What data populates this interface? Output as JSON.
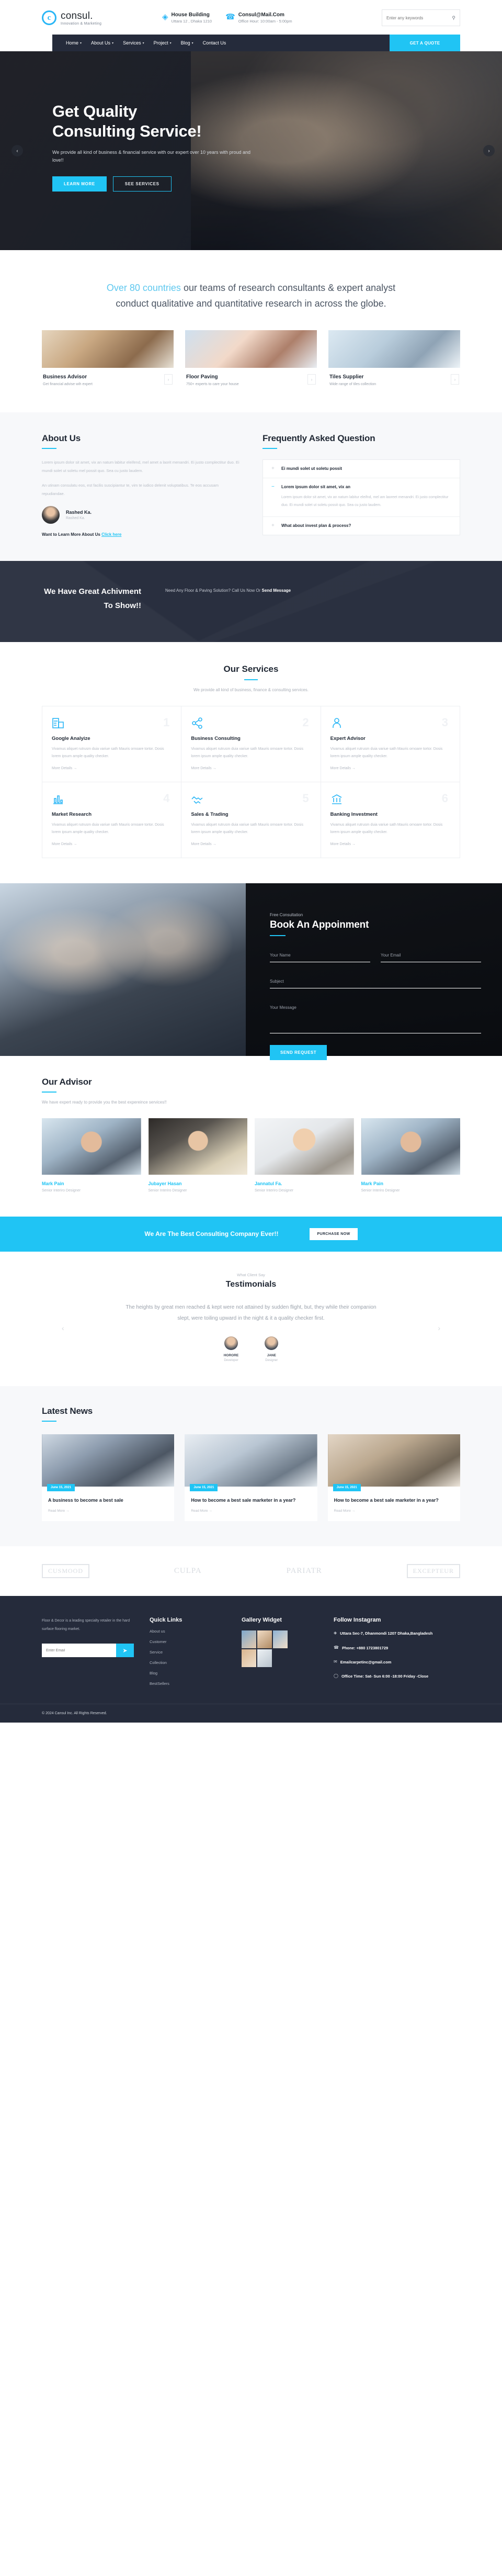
{
  "header": {
    "logo_letter": "c",
    "logo_name": "consul.",
    "logo_tagline": "Innovation & Marketing",
    "info": [
      {
        "icon": "location-pin-icon",
        "title": "House Building",
        "sub": "Uttara 12 , Dhaka 1210"
      },
      {
        "icon": "phone-icon",
        "title": "Consul@Mail.Com",
        "sub": "Office Hour: 10:00am - 5:00pm"
      }
    ],
    "search_placeholder": "Enter any keywords",
    "search_value": ""
  },
  "nav": {
    "items": [
      {
        "label": "Home",
        "has_caret": true
      },
      {
        "label": "About Us",
        "has_caret": true
      },
      {
        "label": "Services",
        "has_caret": true
      },
      {
        "label": "Project",
        "has_caret": true
      },
      {
        "label": "Blog",
        "has_caret": true
      },
      {
        "label": "Contact Us",
        "has_caret": false
      }
    ],
    "quote_label": "GET A QUOTE"
  },
  "hero": {
    "title_line1": "Get Quality",
    "title_line2": "Consulting Service!",
    "subtitle": "We provide all kind of business & financial service with our expert over 10 years with proud and love!!",
    "btn_primary": "LEARN MORE",
    "btn_secondary": "SEE SERVICES",
    "arrow_prev": "‹",
    "arrow_next": "›"
  },
  "intro": {
    "highlight": "Over 80 countries",
    "rest": " our teams of research consultants & expert analyst conduct qualitative and quantitative research in across the globe."
  },
  "feature_cards": [
    {
      "title": "Business Advisor",
      "sub": "Get financial advise wih expert",
      "arrow": "›"
    },
    {
      "title": "Floor Paving",
      "sub": "750+ experts to care your house",
      "arrow": "›"
    },
    {
      "title": "Tiles Supplier",
      "sub": "Wide range of tiles collection",
      "arrow": "›"
    }
  ],
  "about": {
    "heading": "About Us",
    "paragraph1": "Lorem ipsum dolor sit amet, vix an natum labitur eleifend, mel amet a laorit menandri. Ei justo complectitur duo. Ei mundi solet ut soletu mel possit quo. Sea cu justo laudem.",
    "paragraph2": "An utinam consulatu eos, est facilis suscipiantur te, vim te iudico delenit voluptatibus. Te eos accusam repudiandae.",
    "author_name": "Rashed Ka.",
    "author_role": "Rashed Ka.",
    "learn_more_text": "Want to Learn More About Us ",
    "learn_more_link": "Click here"
  },
  "faq": {
    "heading": "Frequently Asked Question",
    "items": [
      {
        "sign": "+",
        "question": "Ei mundi solet ut soletu possit",
        "answer": "",
        "open": false
      },
      {
        "sign": "−",
        "question": "Lorem ipsum dolor sit amet, vix an",
        "answer": "Lorem ipsum dolor sit amet, vix an natum labitur eleifnd, mel am laoreet menandri. Ei justo complectitur duo. Ei mundi solet ut soletu possit quo. Sea cu justo laudem.",
        "open": true
      },
      {
        "sign": "+",
        "question": "What about invest plan & process?",
        "answer": "",
        "open": false
      }
    ]
  },
  "cta_dark": {
    "title": "We Have Great Achivment To Show!!",
    "line_before": "Need Any Floor & Paving Solution? Call Us Now Or ",
    "line_bold": "Send Message"
  },
  "services": {
    "heading": "Our Services",
    "subtitle": "We provide all kind of business, finance & consulting services.",
    "more_label": "More Details →",
    "items": [
      {
        "num": "1",
        "icon": "calculator-icon",
        "title": "Google Analyize",
        "text": "Vivamus aliquet rutrusm duia variue sath Mauris ornoare tortor. Dosis lorem ipsum ample quality checker."
      },
      {
        "num": "2",
        "icon": "share-nodes-icon",
        "title": "Business Consulting",
        "text": "Vivamus aliquet rutrusm duia variue sath Mauris ornoare tortor. Dosis lorem ipsum ample quality checker."
      },
      {
        "num": "3",
        "icon": "user-tie-icon",
        "title": "Expert Advisor",
        "text": "Vivamus aliquet rutrusm duia variue sath Mauris ornoare tortor. Dosis lorem ipsum ample quality checker."
      },
      {
        "num": "4",
        "icon": "chart-bar-icon",
        "title": "Market Research",
        "text": "Vivamus aliquet rutrusm duia variue sath Mauris ornoare tortor. Dosis lorem ipsum ample quality checker."
      },
      {
        "num": "5",
        "icon": "handshake-icon",
        "title": "Sales & Trading",
        "text": "Vivamus aliquet rutrusm duia variue sath Mauris ornoare tortor. Dosis lorem ipsum ample quality checker."
      },
      {
        "num": "6",
        "icon": "bank-icon",
        "title": "Banking Investment",
        "text": "Vivamus aliquet rutrusm duia variue sath Mauris ornoare tortor. Dosis lorem ipsum ample quality checker."
      }
    ]
  },
  "appointment": {
    "eyebrow": "Free Consultation",
    "heading": "Book An Appoinment",
    "name_placeholder": "Your Name",
    "email_placeholder": "Your Email",
    "subject_placeholder": "Subject",
    "message_placeholder": "Your Message",
    "submit_label": "SEND REQUEST"
  },
  "advisors": {
    "heading": "Our Advisor",
    "subtitle": "We have expert ready to provide you the best expereince services!!",
    "items": [
      {
        "name": "Mark Pain",
        "role": "Senior Interiro Designer"
      },
      {
        "name": "Jubayer Hasan",
        "role": "Senior Interiro Designer"
      },
      {
        "name": "Jannatul Fa.",
        "role": "Senior Interiro Designer"
      },
      {
        "name": "Mark Pain",
        "role": "Senior Interiro Designer"
      }
    ]
  },
  "blue_bar": {
    "title": "We Are The Best Consulting Company Ever!!",
    "button": "PURCHASE NOW"
  },
  "testimonials": {
    "eyebrow": "What Client Say",
    "heading": "Testimonials",
    "quote": "The heights by great men reached & kept were not attained by sudden flight, but, they while their companion slept, were toiling upward in the night & it a quality checker first.",
    "arrow_prev": "‹",
    "arrow_next": "›",
    "people": [
      {
        "name": "HORORE",
        "role": "Developer"
      },
      {
        "name": "JANE",
        "role": "Designer"
      }
    ]
  },
  "news": {
    "heading": "Latest News",
    "more_label": "Read More →",
    "items": [
      {
        "date": "June 15, 2021",
        "title": "A business to become a best sale"
      },
      {
        "date": "June 15, 2021",
        "title": "How to become a best sale marketer in a year?"
      },
      {
        "date": "June 15, 2021",
        "title": "How to become a best sale marketer in a year?"
      }
    ]
  },
  "brands": [
    {
      "label": "CUSMOOD",
      "boxed": true
    },
    {
      "label": "CULPA",
      "boxed": false
    },
    {
      "label": "PARIATR",
      "boxed": false
    },
    {
      "label": "EXCEPTEUR",
      "boxed": true
    }
  ],
  "footer": {
    "about": "Floor & Decor is a leading specialty retailer in the hard surface flooring market.",
    "email_placeholder": "Enter Email",
    "send_icon": "paper-plane-icon",
    "quick_links_title": "Quick Links",
    "quick_links": [
      "About us",
      "Customer",
      "Service",
      "Collection",
      "Blog",
      "BestSellers"
    ],
    "gallery_title": "Gallery Widget",
    "instagram_title": "Follow Instagram",
    "contacts": [
      {
        "icon": "location-pin-icon",
        "text": "Uttara Sec-7, Dhanmondi 1207 Dhaka,Bangladesh"
      },
      {
        "icon": "phone-icon",
        "text": "Phone: +880 1723801729"
      },
      {
        "icon": "envelope-icon",
        "text": "Emailcarpetinc@gmail.com"
      },
      {
        "icon": "clock-icon",
        "text": "Office Time: Sat- Sun 6:00 -18:00 Friday -Close"
      }
    ],
    "copyright": "© 2024 Cansul Inc. All Rights Reserved."
  }
}
